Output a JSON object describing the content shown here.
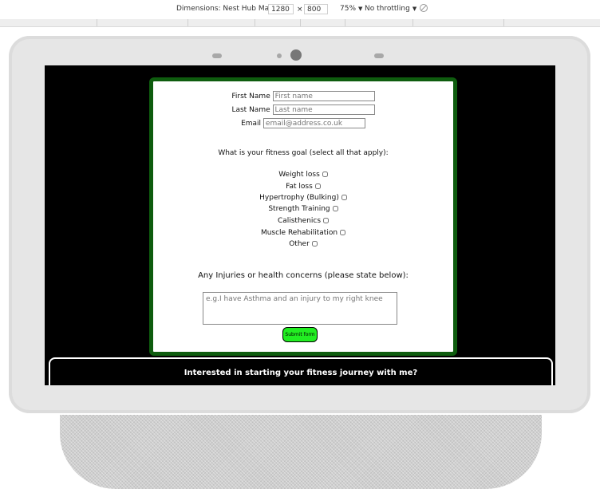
{
  "devtools": {
    "dimensions_label": "Dimensions: Nest Hub Max",
    "width_value": "1280",
    "times_sign": "×",
    "height_value": "800",
    "zoom_label": "75%",
    "throttle_label": "No throttling"
  },
  "form": {
    "first_name_label": "First Name",
    "first_name_placeholder": "First name",
    "last_name_label": "Last Name",
    "last_name_placeholder": "Last name",
    "email_label": "Email",
    "email_placeholder": "email@address.co.uk",
    "goal_question": "What is your fitness goal (select all that apply):",
    "goals": [
      {
        "label": "Weight loss",
        "checked": false
      },
      {
        "label": "Fat loss",
        "checked": false
      },
      {
        "label": "Hypertrophy (Bulking)",
        "checked": false
      },
      {
        "label": "Strength Training",
        "checked": false
      },
      {
        "label": "Calisthenics",
        "checked": false
      },
      {
        "label": "Muscle Rehabilitation",
        "checked": false
      },
      {
        "label": "Other",
        "checked": false
      }
    ],
    "injuries_question": "Any Injuries or health concerns (please state below):",
    "injuries_placeholder": "e.g.I have Asthma and an injury to my right knee",
    "submit_label": "Submit form"
  },
  "cta": {
    "text": "Interested in starting your fitness journey with me?"
  },
  "colors": {
    "form_border": "#0e5c0e",
    "submit_bg": "#22ee22",
    "screen_bg": "#000000"
  }
}
